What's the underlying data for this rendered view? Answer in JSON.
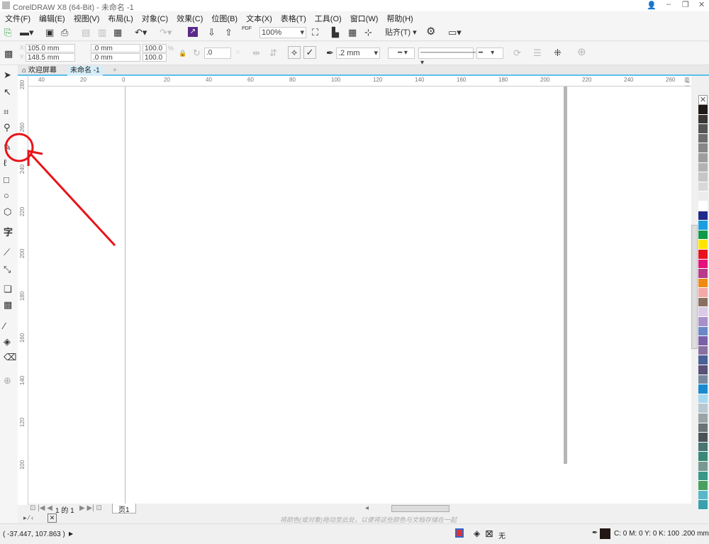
{
  "app": {
    "title": "CorelDRAW X8 (64-Bit) - 未命名 -1"
  },
  "menu": [
    "文件(F)",
    "编辑(E)",
    "视图(V)",
    "布局(L)",
    "对象(C)",
    "效果(C)",
    "位图(B)",
    "文本(X)",
    "表格(T)",
    "工具(O)",
    "窗口(W)",
    "帮助(H)"
  ],
  "toolbar": {
    "zoom": "100%",
    "snap": "贴齐(T)",
    "pdf": "PDF"
  },
  "property_bar": {
    "x": "105.0 mm",
    "y": "148.5 mm",
    "w": ".0 mm",
    "h": ".0 mm",
    "sx": "100.0",
    "sy": "100.0",
    "pct": "%",
    "angle": ".0",
    "outline": ".2 mm"
  },
  "tabs": {
    "welcome": "欢迎屏幕",
    "doc": "未命名 -1"
  },
  "ruler": {
    "unit": "毫米",
    "h_labels": [
      "40",
      "20",
      "0",
      "20",
      "40",
      "60",
      "80",
      "100",
      "120",
      "140",
      "160",
      "180",
      "200",
      "220",
      "240",
      "260"
    ],
    "v_labels": [
      "280",
      "260",
      "240",
      "220",
      "200",
      "180",
      "160",
      "140",
      "120",
      "100"
    ]
  },
  "palette": [
    "#1e1a18",
    "#3a3634",
    "#555",
    "#6e6e6e",
    "#888",
    "#9e9e9e",
    "#b3b3b3",
    "#c6c6c6",
    "#d9d9d9",
    "#ececec",
    "#ffffff",
    "#1f2a8c",
    "#1a9ee0",
    "#0f9a48",
    "#ffe600",
    "#e8121f",
    "#e4117b",
    "#b83a8a",
    "#f08a12",
    "#f4a8a8",
    "#8a7060",
    "#d8cce8",
    "#a890c8",
    "#6a88c8",
    "#7a60a8",
    "#8a70a0",
    "#4a6098",
    "#5a5078",
    "#7888a0",
    "#1a8ad0",
    "#a8d8f0",
    "#b8c8d0",
    "#98a4a8",
    "#6a7478",
    "#4a5458",
    "#4a7470",
    "#3a8878",
    "#789890",
    "#3a9888",
    "#4aa060",
    "#58b8c8",
    "#3aa0b0"
  ],
  "pagebar": {
    "page_of": "1 的 1",
    "page_tab": "页1"
  },
  "docpal_hint": "将颜色(或对象)拖动至此处，以便将这些颜色与文档存储在一起",
  "status": {
    "coords": "( -37.447, 107.863 )",
    "fill": "无",
    "outline": "C: 0 M: 0 Y: 0 K: 100  .200 mm"
  },
  "annotation_color": "#e8141a"
}
